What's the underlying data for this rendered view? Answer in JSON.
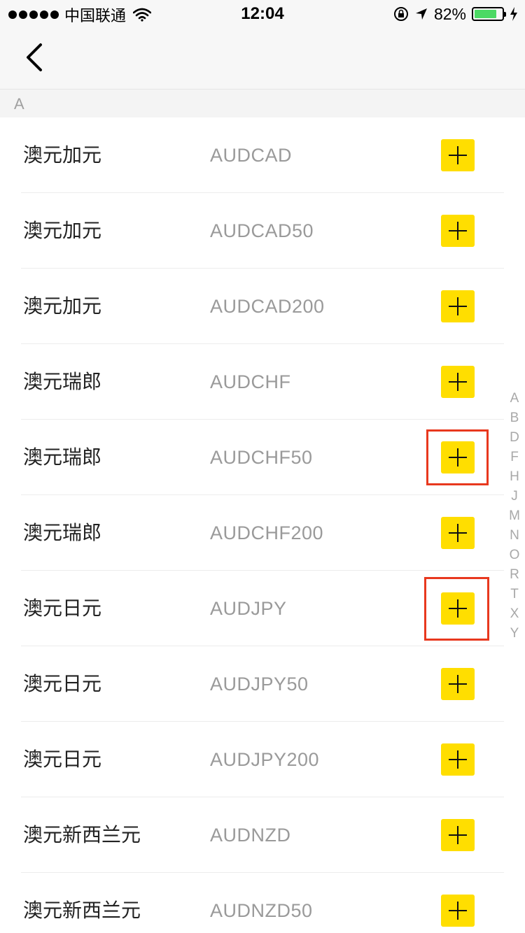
{
  "status_bar": {
    "carrier": "中国联通",
    "time": "12:04",
    "battery_percent": "82%",
    "battery_level": 0.82,
    "signal_dots": 5,
    "icons": [
      "wifi-icon",
      "orientation-lock-icon",
      "location-arrow-icon",
      "battery-icon",
      "charging-bolt-icon"
    ]
  },
  "nav": {
    "back_icon": "chevron-left-icon"
  },
  "section": {
    "letter": "A"
  },
  "rows": [
    {
      "name": "澳元加元",
      "code": "AUDCAD"
    },
    {
      "name": "澳元加元",
      "code": "AUDCAD50"
    },
    {
      "name": "澳元加元",
      "code": "AUDCAD200"
    },
    {
      "name": "澳元瑞郎",
      "code": "AUDCHF"
    },
    {
      "name": "澳元瑞郎",
      "code": "AUDCHF50"
    },
    {
      "name": "澳元瑞郎",
      "code": "AUDCHF200"
    },
    {
      "name": "澳元日元",
      "code": "AUDJPY"
    },
    {
      "name": "澳元日元",
      "code": "AUDJPY50"
    },
    {
      "name": "澳元日元",
      "code": "AUDJPY200"
    },
    {
      "name": "澳元新西兰元",
      "code": "AUDNZD"
    },
    {
      "name": "澳元新西兰元",
      "code": "AUDNZD50"
    }
  ],
  "add_button": {
    "icon": "plus-icon",
    "color": "#ffde00"
  },
  "highlight_color": "#e8381e",
  "index_letters": [
    "A",
    "B",
    "D",
    "F",
    "H",
    "J",
    "M",
    "N",
    "O",
    "R",
    "T",
    "X",
    "Y"
  ]
}
